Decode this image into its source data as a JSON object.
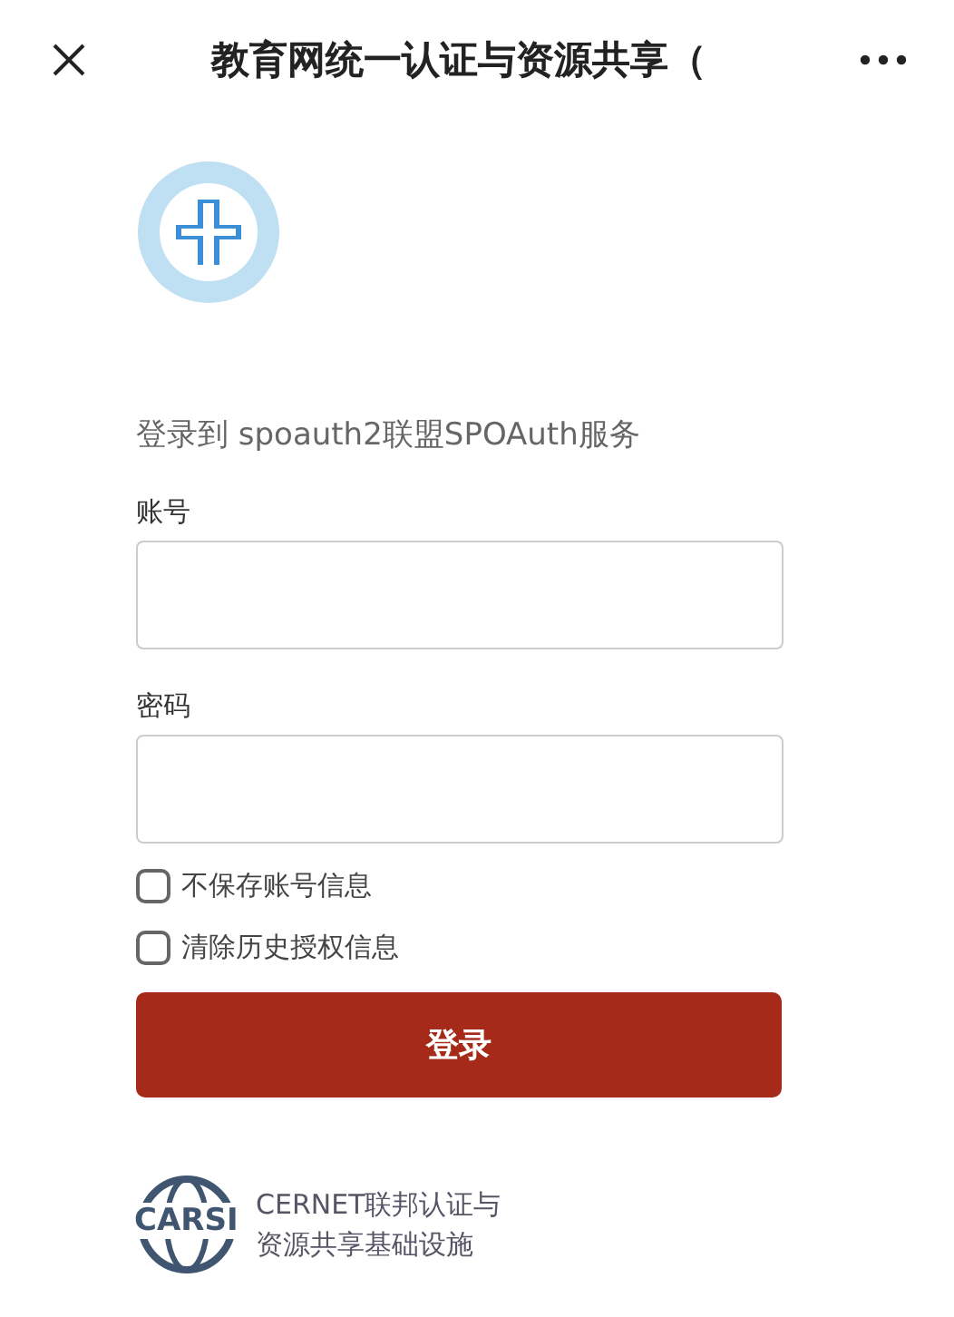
{
  "top_bar": {
    "title": "教育网统一认证与资源共享（"
  },
  "intro": "登录到 spoauth2联盟SPOAuth服务",
  "fields": [
    {
      "label": "账号"
    },
    {
      "label": "密码"
    }
  ],
  "options": [
    {
      "label": "不保存账号信息",
      "checked": false
    },
    {
      "label": "清除历史授权信息",
      "checked": false
    }
  ],
  "login_button": "登录",
  "footer": {
    "logo_text": "CARSI",
    "lines": [
      "CERNET联邦认证与",
      "资源共享基础设施"
    ]
  }
}
